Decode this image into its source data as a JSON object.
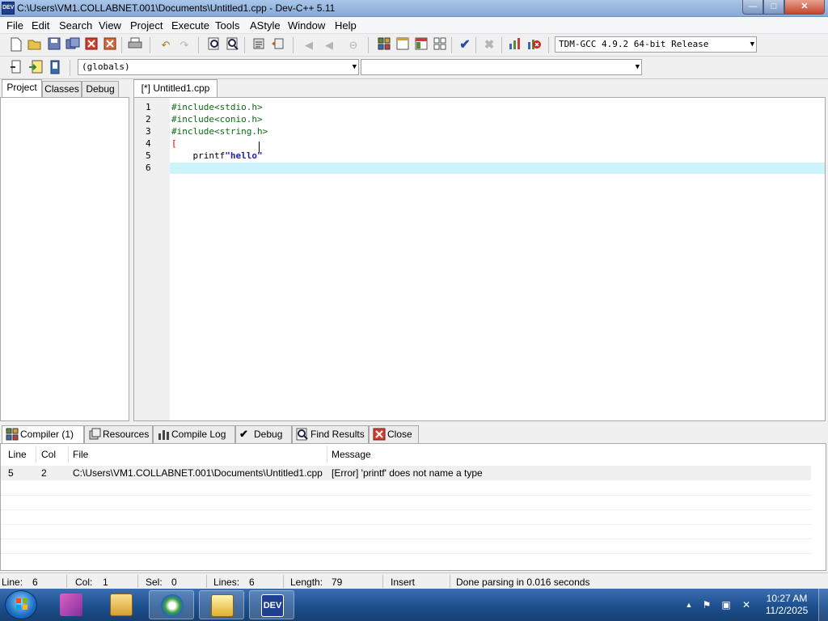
{
  "window": {
    "title": "C:\\Users\\VM1.COLLABNET.001\\Documents\\Untitled1.cpp - Dev-C++ 5.11",
    "app_icon_text": "DEV",
    "minimize_glyph": "—",
    "maximize_glyph": "□",
    "close_glyph": "✕"
  },
  "menu": [
    "File",
    "Edit",
    "Search",
    "View",
    "Project",
    "Execute",
    "Tools",
    "AStyle",
    "Window",
    "Help"
  ],
  "toolbar": {
    "compiler_select": "TDM-GCC 4.9.2 64-bit Release",
    "scope_select": "(globals)",
    "symbol_select": ""
  },
  "left_tabs": [
    "Project",
    "Classes",
    "Debug"
  ],
  "editor": {
    "tab_label": "[*] Untitled1.cpp",
    "lines": [
      {
        "num": "1",
        "text": "#include<stdio.h>"
      },
      {
        "num": "2",
        "text": "#include<conio.h>"
      },
      {
        "num": "3",
        "text": "#include<string.h>"
      },
      {
        "num": "4",
        "text": "["
      },
      {
        "num": "5",
        "text_prefix": "    printf",
        "text_string": "\"hello\""
      },
      {
        "num": "6",
        "text": ""
      }
    ]
  },
  "bottom_tabs": [
    {
      "label": "Compiler (1)",
      "icon": "grid-icon"
    },
    {
      "label": "Resources",
      "icon": "resources-icon"
    },
    {
      "label": "Compile Log",
      "icon": "chart-icon"
    },
    {
      "label": "Debug",
      "icon": "check-icon"
    },
    {
      "label": "Find Results",
      "icon": "find-icon"
    },
    {
      "label": "Close",
      "icon": "close-icon"
    }
  ],
  "messages": {
    "headers": {
      "line": "Line",
      "col": "Col",
      "file": "File",
      "message": "Message"
    },
    "rows": [
      {
        "line": "5",
        "col": "2",
        "file": "C:\\Users\\VM1.COLLABNET.001\\Documents\\Untitled1.cpp",
        "message": "[Error] 'printf' does not name a type"
      }
    ]
  },
  "status": {
    "line_label": "Line:",
    "line_value": "6",
    "col_label": "Col:",
    "col_value": "1",
    "sel_label": "Sel:",
    "sel_value": "0",
    "lines_label": "Lines:",
    "lines_value": "6",
    "length_label": "Length:",
    "length_value": "79",
    "mode": "Insert",
    "message": "Done parsing in 0.016 seconds"
  },
  "taskbar": {
    "time": "10:27 AM",
    "date": "11/2/2025",
    "dev_app_text": "DEV"
  },
  "colors": {
    "active_line": "#ccf4fc",
    "preprocessor": "#0d6a14",
    "string": "#1e1ea8",
    "error": "#e00000"
  }
}
